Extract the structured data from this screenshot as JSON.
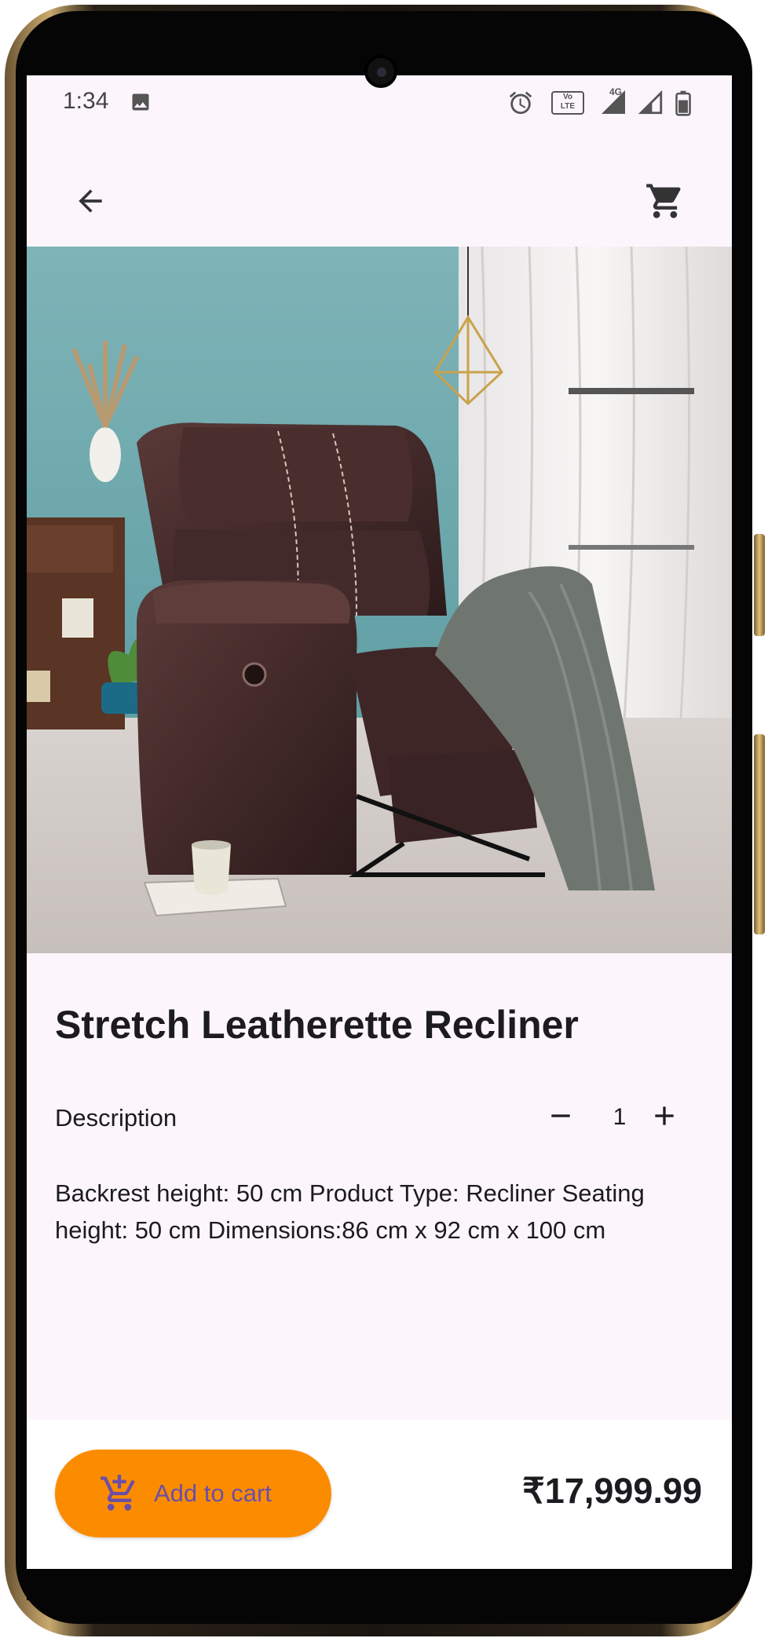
{
  "status_bar": {
    "time": "1:34",
    "network": "4G"
  },
  "app_bar": {
    "back_icon": "arrow-back-icon",
    "cart_icon": "shopping-cart-icon"
  },
  "product": {
    "title": "Stretch Leatherette Recliner",
    "description_label": "Description",
    "quantity": "1",
    "description": "Backrest height: 50 cm Product Type: Recliner Seating height: 50 cm Dimensions:86 cm x 92 cm x 100 cm",
    "price": "₹17,999.99"
  },
  "actions": {
    "add_to_cart_label": "Add to cart"
  },
  "colors": {
    "accent": "#fb8c00",
    "button_text": "#6b4ea8",
    "background": "#fcf6fc"
  }
}
